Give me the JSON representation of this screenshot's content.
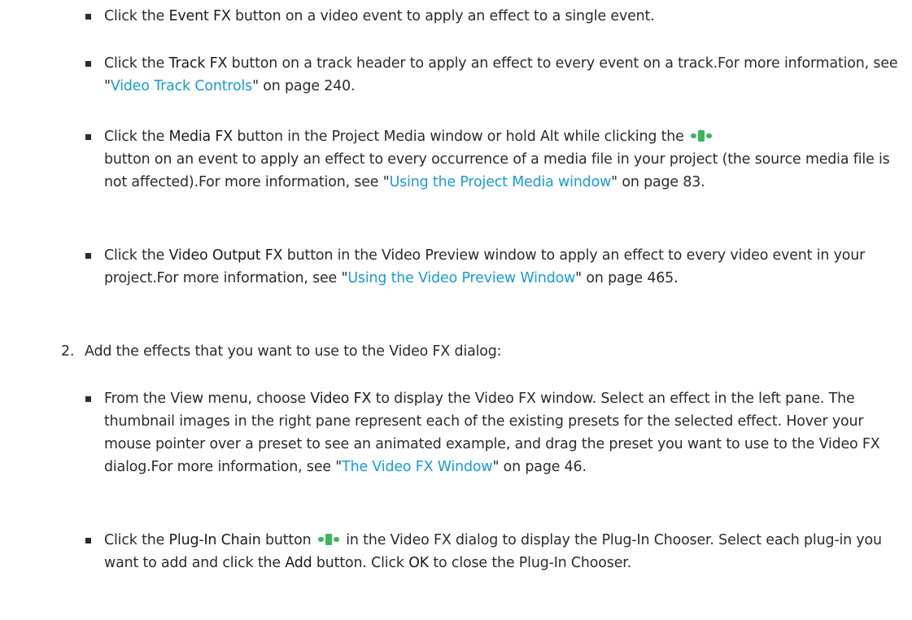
{
  "items": [
    {
      "pre": "Click the ",
      "bold": "Event FX",
      "post": " button on a video event to apply an effect to a single event."
    },
    {
      "pre": "Click the ",
      "bold": "Track FX",
      "post": " button on a track header to apply an effect to every event on a track.For more information, see \"",
      "link": "Video Track Controls",
      "tail": "\" on page 240."
    },
    {
      "pre": "Click the ",
      "bold": "Media FX",
      "mid": " button in the Project Media window or hold Alt while clicking the",
      "post": "button on an event to apply an effect to every occurrence of a media file in your project (the source media file is not affected).For more information, see \"",
      "link": "Using the Project Media window",
      "tail": "\" on page 83."
    },
    {
      "pre": "Click the ",
      "bold": "Video Output FX",
      "post": " button in the Video Preview window to apply an effect to every video event in your project.For more information, see \"",
      "link": "Using the Video Preview Window",
      "tail": "\" on page 465."
    }
  ],
  "step2": {
    "number": "2.",
    "text": "Add the effects that you want to use to the Video FX dialog:"
  },
  "subitems": [
    {
      "pre": "From the View menu, choose ",
      "bold": "Video FX",
      "post": " to display the Video FX window. Select an effect in the left pane. The thumbnail images in the right pane represent each of the existing presets for the selected effect. Hover your mouse pointer over a preset to see an animated example, and drag the preset you want to use to the Video FX dialog.For more information, see \"",
      "link": "The Video FX Window",
      "tail": "\" on page 46."
    },
    {
      "pre": "Click the ",
      "bold": "Plug-In Chain",
      "mid": " button",
      "post": "in the Video FX dialog to display the Plug-In Chooser. Select each plug-in you want to add and click the ",
      "bold2": "Add",
      "post2": " button. Click ",
      "bold3": "OK",
      "tail": " to close the Plug-In Chooser."
    }
  ],
  "icons": [
    "plug-in-chain-icon"
  ],
  "colors": {
    "link": "#1a9ad6",
    "text": "#2b2b2b",
    "icon": "#3cb65a"
  }
}
